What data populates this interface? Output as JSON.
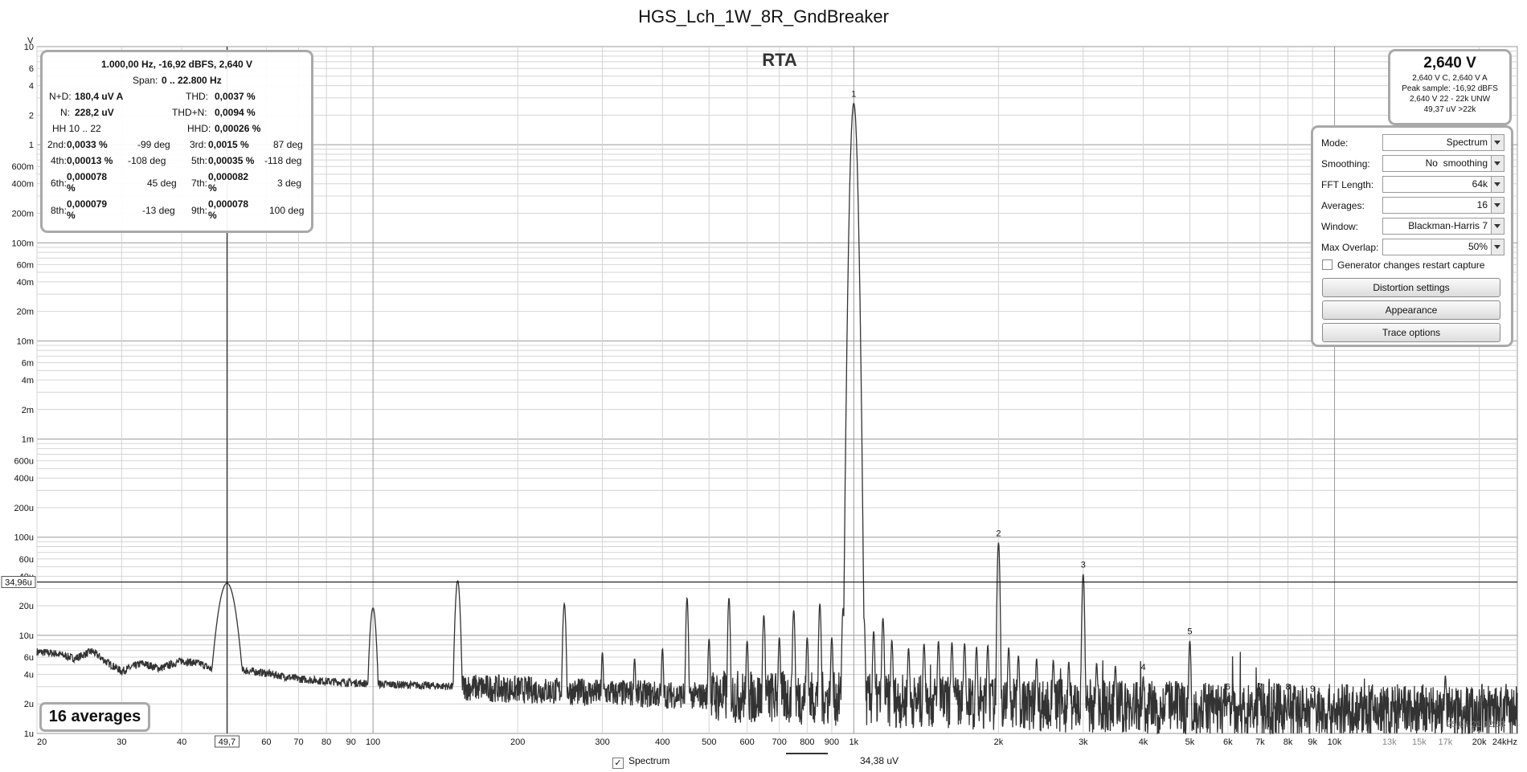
{
  "title": "HGS_Lch_1W_8R_GndBreaker",
  "plot_label": "RTA",
  "chart_data": {
    "type": "line",
    "title": "HGS_Lch_1W_8R_GndBreaker",
    "xlabel": "",
    "ylabel": "V",
    "x_unit": "kHz",
    "xscale": "log",
    "yscale": "log",
    "xlim": [
      20,
      24000
    ],
    "ylim": [
      1e-06,
      10
    ],
    "grid": true,
    "x_major_ticks": [
      {
        "v": 20,
        "l": "20"
      },
      {
        "v": 30,
        "l": "30"
      },
      {
        "v": 40,
        "l": "40"
      },
      {
        "v": 49.7,
        "l": "49,7"
      },
      {
        "v": 60,
        "l": "60"
      },
      {
        "v": 70,
        "l": "70"
      },
      {
        "v": 80,
        "l": "80"
      },
      {
        "v": 90,
        "l": "90"
      },
      {
        "v": 100,
        "l": "100"
      },
      {
        "v": 200,
        "l": "200"
      },
      {
        "v": 300,
        "l": "300"
      },
      {
        "v": 400,
        "l": "400"
      },
      {
        "v": 500,
        "l": "500"
      },
      {
        "v": 600,
        "l": "600"
      },
      {
        "v": 700,
        "l": "700"
      },
      {
        "v": 800,
        "l": "800"
      },
      {
        "v": 900,
        "l": "900"
      },
      {
        "v": 1000,
        "l": "1k"
      },
      {
        "v": 2000,
        "l": "2k"
      },
      {
        "v": 3000,
        "l": "3k"
      },
      {
        "v": 4000,
        "l": "4k"
      },
      {
        "v": 5000,
        "l": "5k"
      },
      {
        "v": 6000,
        "l": "6k"
      },
      {
        "v": 7000,
        "l": "7k"
      },
      {
        "v": 8000,
        "l": "8k"
      },
      {
        "v": 9000,
        "l": "9k"
      },
      {
        "v": 10000,
        "l": "10k"
      },
      {
        "v": 13000,
        "l": "13k"
      },
      {
        "v": 15000,
        "l": "15k"
      },
      {
        "v": 17000,
        "l": "17k"
      },
      {
        "v": 20000,
        "l": "20k"
      },
      {
        "v": 24000,
        "l": "24kHz"
      }
    ],
    "y_ticks": [
      {
        "v": 10,
        "l": "10"
      },
      {
        "v": 6,
        "l": "6"
      },
      {
        "v": 4,
        "l": "4"
      },
      {
        "v": 2,
        "l": "2"
      },
      {
        "v": 1,
        "l": "1"
      },
      {
        "v": 0.6,
        "l": "600m"
      },
      {
        "v": 0.4,
        "l": "400m"
      },
      {
        "v": 0.2,
        "l": "200m"
      },
      {
        "v": 0.1,
        "l": "100m"
      },
      {
        "v": 0.06,
        "l": "60m"
      },
      {
        "v": 0.04,
        "l": "40m"
      },
      {
        "v": 0.02,
        "l": "20m"
      },
      {
        "v": 0.01,
        "l": "10m"
      },
      {
        "v": 0.006,
        "l": "6m"
      },
      {
        "v": 0.004,
        "l": "4m"
      },
      {
        "v": 0.002,
        "l": "2m"
      },
      {
        "v": 0.001,
        "l": "1m"
      },
      {
        "v": 0.0006,
        "l": "600u"
      },
      {
        "v": 0.0004,
        "l": "400u"
      },
      {
        "v": 0.0002,
        "l": "200u"
      },
      {
        "v": 0.0001,
        "l": "100u"
      },
      {
        "v": 6e-05,
        "l": "60u"
      },
      {
        "v": 4e-05,
        "l": "40u"
      },
      {
        "v": 2e-05,
        "l": "20u"
      },
      {
        "v": 1e-05,
        "l": "10u"
      },
      {
        "v": 6e-06,
        "l": "6u"
      },
      {
        "v": 4e-06,
        "l": "4u"
      },
      {
        "v": 2e-06,
        "l": "2u"
      },
      {
        "v": 1e-06,
        "l": "1u"
      }
    ],
    "cursor": {
      "x": 49.7,
      "x_label": "49,7",
      "y": 3.496e-05,
      "y_label": "34,96u"
    },
    "series": [
      {
        "name": "Spectrum",
        "color": "#333333",
        "noise_floor_points": [
          [
            20,
            6.8e-06
          ],
          [
            22,
            6.5e-06
          ],
          [
            24,
            5.8e-06
          ],
          [
            26,
            6.9e-06
          ],
          [
            28,
            5.3e-06
          ],
          [
            30,
            4.3e-06
          ],
          [
            33,
            5.2e-06
          ],
          [
            36,
            4.6e-06
          ],
          [
            40,
            5.5e-06
          ],
          [
            44,
            5.1e-06
          ],
          [
            47,
            4.3e-06
          ],
          [
            49.7,
            3.4e-05
          ],
          [
            52,
            4.5e-06
          ],
          [
            60,
            4.1e-06
          ],
          [
            70,
            3.6e-06
          ],
          [
            80,
            3.4e-06
          ],
          [
            100,
            3.2e-06
          ],
          [
            150,
            3e-06
          ],
          [
            200,
            2.8e-06
          ],
          [
            300,
            2.6e-06
          ],
          [
            500,
            2.4e-06
          ],
          [
            800,
            2.3e-06
          ],
          [
            1000,
            2.2e-06
          ],
          [
            2000,
            2e-06
          ],
          [
            5000,
            1.8e-06
          ],
          [
            10000,
            1.7e-06
          ],
          [
            24000,
            1.7e-06
          ]
        ],
        "peaks": [
          {
            "f": 49.7,
            "v": 3.4e-05,
            "w": 0.022
          },
          {
            "f": 100,
            "v": 1.9e-05,
            "w": 0.008
          },
          {
            "f": 150,
            "v": 3.6e-05,
            "w": 0.006
          },
          {
            "f": 250,
            "v": 2.1e-05,
            "w": 0.004
          },
          {
            "f": 300,
            "v": 6.7e-06,
            "w": 0.003
          },
          {
            "f": 350,
            "v": 5.8e-06,
            "w": 0.003
          },
          {
            "f": 400,
            "v": 7.3e-06,
            "w": 0.003
          },
          {
            "f": 450,
            "v": 2.4e-05,
            "w": 0.003
          },
          {
            "f": 500,
            "v": 9.2e-06,
            "w": 0.003
          },
          {
            "f": 550,
            "v": 2.4e-05,
            "w": 0.003
          },
          {
            "f": 600,
            "v": 8.8e-06,
            "w": 0.003
          },
          {
            "f": 650,
            "v": 1.6e-05,
            "w": 0.003
          },
          {
            "f": 700,
            "v": 9.5e-06,
            "w": 0.003
          },
          {
            "f": 750,
            "v": 1.8e-05,
            "w": 0.003
          },
          {
            "f": 800,
            "v": 9.5e-06,
            "w": 0.003
          },
          {
            "f": 850,
            "v": 2.1e-05,
            "w": 0.003
          },
          {
            "f": 900,
            "v": 9.5e-06,
            "w": 0.003
          },
          {
            "f": 950,
            "v": 1.9e-05,
            "w": 0.003
          },
          {
            "f": 1000,
            "v": 2.64,
            "w": 0.006
          },
          {
            "f": 1050,
            "v": 1.5e-05,
            "w": 0.003
          },
          {
            "f": 1100,
            "v": 1.1e-05,
            "w": 0.003
          },
          {
            "f": 1150,
            "v": 1.5e-05,
            "w": 0.003
          },
          {
            "f": 1200,
            "v": 8.9e-06,
            "w": 0.003
          },
          {
            "f": 1300,
            "v": 7.4e-06,
            "w": 0.003
          },
          {
            "f": 1400,
            "v": 8.2e-06,
            "w": 0.003
          },
          {
            "f": 1500,
            "v": 8.7e-06,
            "w": 0.003
          },
          {
            "f": 1600,
            "v": 8.5e-06,
            "w": 0.003
          },
          {
            "f": 1700,
            "v": 8.3e-06,
            "w": 0.003
          },
          {
            "f": 1800,
            "v": 7.6e-06,
            "w": 0.003
          },
          {
            "f": 1900,
            "v": 7.9e-06,
            "w": 0.003
          },
          {
            "f": 2000,
            "v": 8.8e-05,
            "w": 0.003
          },
          {
            "f": 2100,
            "v": 7.5e-06,
            "w": 0.003
          },
          {
            "f": 2200,
            "v": 6.2e-06,
            "w": 0.003
          },
          {
            "f": 2400,
            "v": 5.8e-06,
            "w": 0.003
          },
          {
            "f": 2600,
            "v": 5.6e-06,
            "w": 0.003
          },
          {
            "f": 2800,
            "v": 5.4e-06,
            "w": 0.003
          },
          {
            "f": 3000,
            "v": 4.2e-05,
            "w": 0.003
          },
          {
            "f": 3200,
            "v": 5.2e-06,
            "w": 0.003
          },
          {
            "f": 3500,
            "v": 4.9e-06,
            "w": 0.003
          },
          {
            "f": 4000,
            "v": 3.8e-06,
            "w": 0.003
          },
          {
            "f": 4500,
            "v": 3.1e-06,
            "w": 0.003
          },
          {
            "f": 5000,
            "v": 8.8e-06,
            "w": 0.003
          },
          {
            "f": 6000,
            "v": 2.4e-06,
            "w": 0.003
          },
          {
            "f": 7000,
            "v": 2.4e-06,
            "w": 0.003
          },
          {
            "f": 8000,
            "v": 2.4e-06,
            "w": 0.003
          },
          {
            "f": 9000,
            "v": 2.3e-06,
            "w": 0.003
          },
          {
            "f": 17000,
            "v": 3.9e-06,
            "w": 0.003
          }
        ]
      }
    ],
    "harmonic_markers": [
      {
        "n": "1",
        "f": 1000,
        "v": 2.64
      },
      {
        "n": "2",
        "f": 2000,
        "v": 8.8e-05
      },
      {
        "n": "3",
        "f": 3000,
        "v": 4.2e-05
      },
      {
        "n": "4",
        "f": 4000,
        "v": 3.8e-06
      },
      {
        "n": "5",
        "f": 5000,
        "v": 8.8e-06
      },
      {
        "n": "6",
        "f": 6000,
        "v": 2.4e-06
      },
      {
        "n": "7",
        "f": 7000,
        "v": 2.4e-06
      },
      {
        "n": "8",
        "f": 8000,
        "v": 2.4e-06
      },
      {
        "n": "9",
        "f": 9000,
        "v": 2.3e-06
      }
    ]
  },
  "distortion": {
    "header": "1.000,00 Hz, -16,92 dBFS, 2,640 V",
    "span_label": "Span:",
    "span_value": "0 .. 22.800 Hz",
    "nd_label": "N+D:",
    "nd_value": "180,4 uV A",
    "thd_label": "THD:",
    "thd_value": "0,0037 %",
    "n_label": "N:",
    "n_value": "228,2 uV",
    "thdn_label": "THD+N:",
    "thdn_value": "0,0094 %",
    "hh_label": "HH 10 .. 22",
    "hhd_label": "HHD:",
    "hhd_value": "0,00026 %",
    "harmonics": [
      {
        "l1": "2nd:",
        "v1": "0,0033 %",
        "p1": "-99 deg",
        "l2": "3rd:",
        "v2": "0,0015 %",
        "p2": "87 deg"
      },
      {
        "l1": "4th:",
        "v1": "0,00013 %",
        "p1": "-108 deg",
        "l2": "5th:",
        "v2": "0,00035 %",
        "p2": "-118 deg"
      },
      {
        "l1": "6th:",
        "v1": "0,000078 %",
        "p1": "45 deg",
        "l2": "7th:",
        "v2": "0,000082 %",
        "p2": "3 deg"
      },
      {
        "l1": "8th:",
        "v1": "0,000079 %",
        "p1": "-13 deg",
        "l2": "9th:",
        "v2": "0,000078 %",
        "p2": "100 deg"
      }
    ]
  },
  "reading": {
    "big": "2,640 V",
    "l1": "2,640 V C, 2,640 V A",
    "l2": "Peak sample: -16,92 dBFS",
    "l3": "2,640 V 22 - 22k UNW",
    "l4": "49,37 uV >22k"
  },
  "settings": {
    "mode": {
      "label": "Mode:",
      "value": "Spectrum"
    },
    "smoothing": {
      "label": "Smoothing:",
      "value": "No  smoothing"
    },
    "fft": {
      "label": "FFT Length:",
      "value": "64k"
    },
    "averages": {
      "label": "Averages:",
      "value": "16"
    },
    "window": {
      "label": "Window:",
      "value": "Blackman-Harris 7"
    },
    "overlap": {
      "label": "Max Overlap:",
      "value": "50%"
    },
    "generator_restart": "Generator changes restart capture",
    "distortion_button": "Distortion settings",
    "appearance_button": "Appearance",
    "trace_button": "Trace options"
  },
  "averages_badge": "16 averages",
  "legend": {
    "check": "✓",
    "name": "Spectrum",
    "value": "34,38 uV"
  },
  "timestamp": "25.04.21 12:33"
}
